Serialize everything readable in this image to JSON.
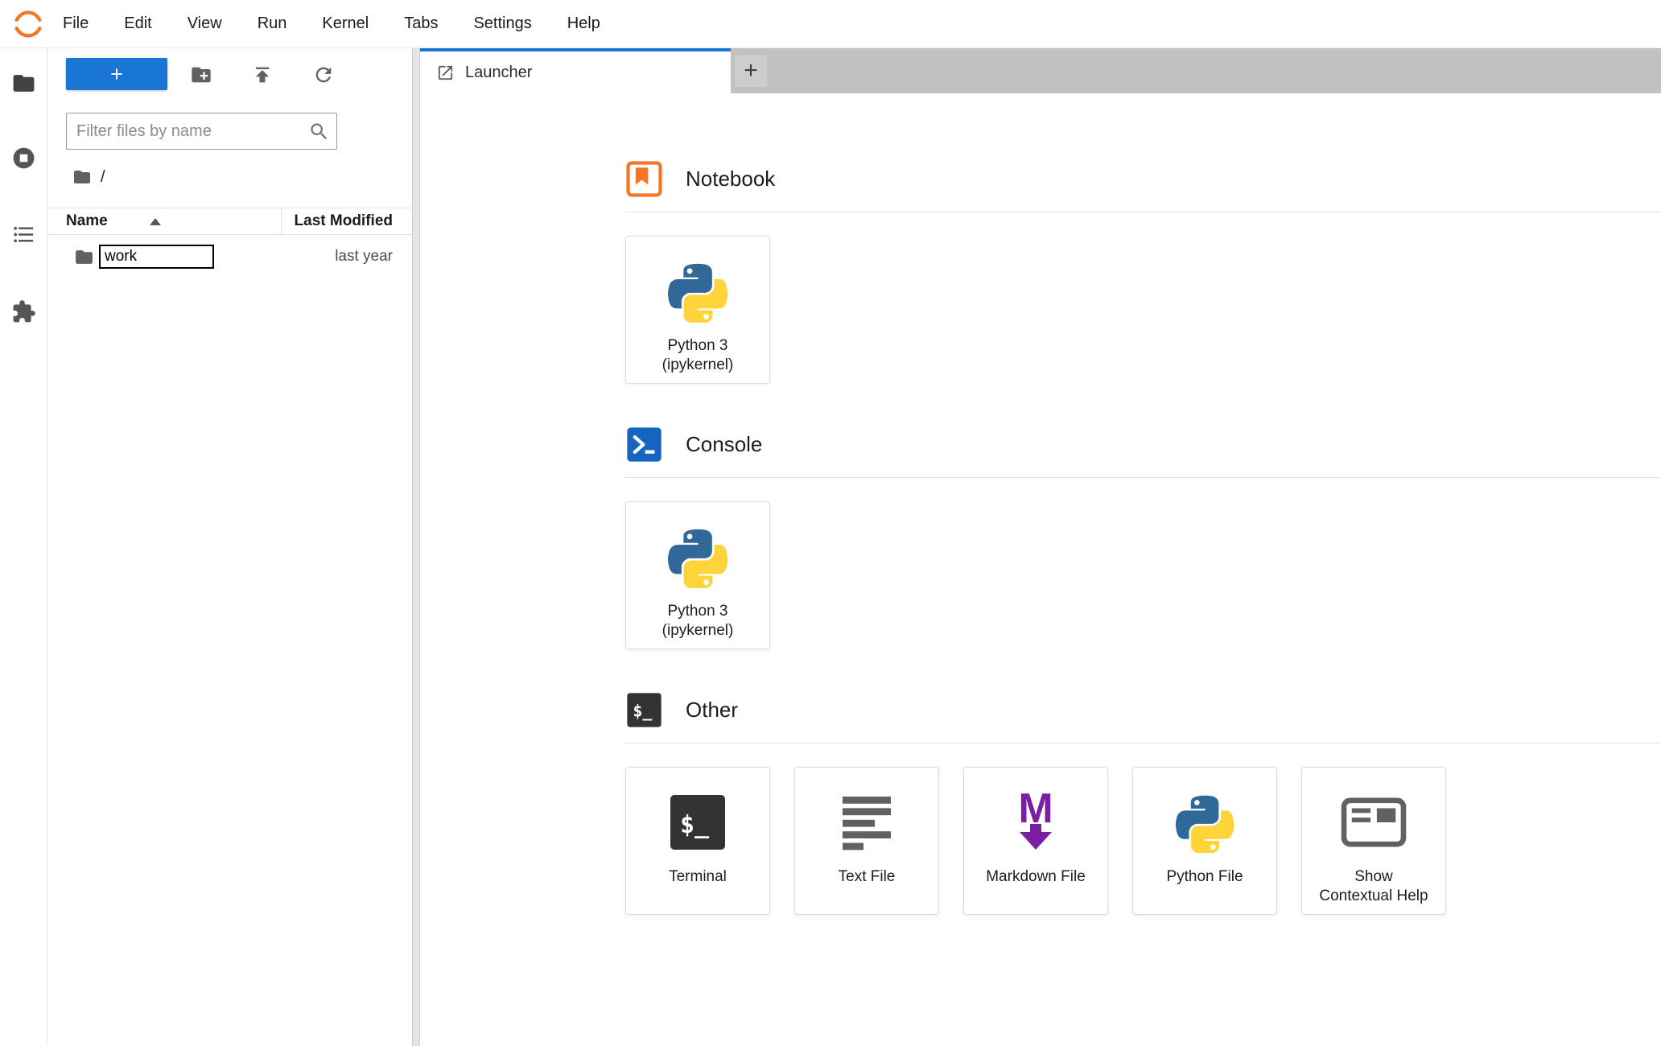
{
  "colors": {
    "accent_blue": "#1976d2",
    "tab_bar_gray": "#c1c1c1",
    "jupyter_orange": "#f37726",
    "console_blue": "#1565c0",
    "terminal_dark": "#333333",
    "markdown_purple": "#7b1fa2",
    "python_blue": "#306998",
    "python_yellow": "#ffd43b",
    "icon_gray": "#616161"
  },
  "menubar": {
    "items": [
      "File",
      "Edit",
      "View",
      "Run",
      "Kernel",
      "Tabs",
      "Settings",
      "Help"
    ]
  },
  "sidebar": {
    "icons": [
      "folder-icon",
      "running-kernels-icon",
      "table-of-contents-icon",
      "extensions-icon"
    ]
  },
  "filebrowser": {
    "toolbar": {
      "new_launcher_label": "+",
      "icons": [
        "new-folder-icon",
        "upload-icon",
        "refresh-icon"
      ]
    },
    "filter": {
      "placeholder": "Filter files by name",
      "value": ""
    },
    "breadcrumb": {
      "root": "/"
    },
    "table": {
      "columns": {
        "name": "Name",
        "modified": "Last Modified"
      },
      "sort_column": "Name",
      "sort_direction": "ascending",
      "rows": [
        {
          "name": "work",
          "modified": "last year",
          "renaming": true
        }
      ]
    }
  },
  "main": {
    "tabs": [
      {
        "label": "Launcher",
        "active": true
      }
    ],
    "add_tab_label": "+"
  },
  "launcher": {
    "sections": [
      {
        "title": "Notebook",
        "icon": "notebook-icon",
        "cards": [
          {
            "icon": "python-icon",
            "lines": [
              "Python 3",
              "(ipykernel)"
            ]
          }
        ]
      },
      {
        "title": "Console",
        "icon": "console-icon",
        "cards": [
          {
            "icon": "python-icon",
            "lines": [
              "Python 3",
              "(ipykernel)"
            ]
          }
        ]
      },
      {
        "title": "Other",
        "icon": "terminal-icon",
        "cards": [
          {
            "icon": "terminal-icon",
            "lines": [
              "Terminal"
            ]
          },
          {
            "icon": "text-file-icon",
            "lines": [
              "Text File"
            ]
          },
          {
            "icon": "markdown-icon",
            "lines": [
              "Markdown File"
            ]
          },
          {
            "icon": "python-icon",
            "lines": [
              "Python File"
            ]
          },
          {
            "icon": "contextual-help-icon",
            "lines": [
              "Show",
              "Contextual Help"
            ]
          }
        ]
      }
    ]
  }
}
